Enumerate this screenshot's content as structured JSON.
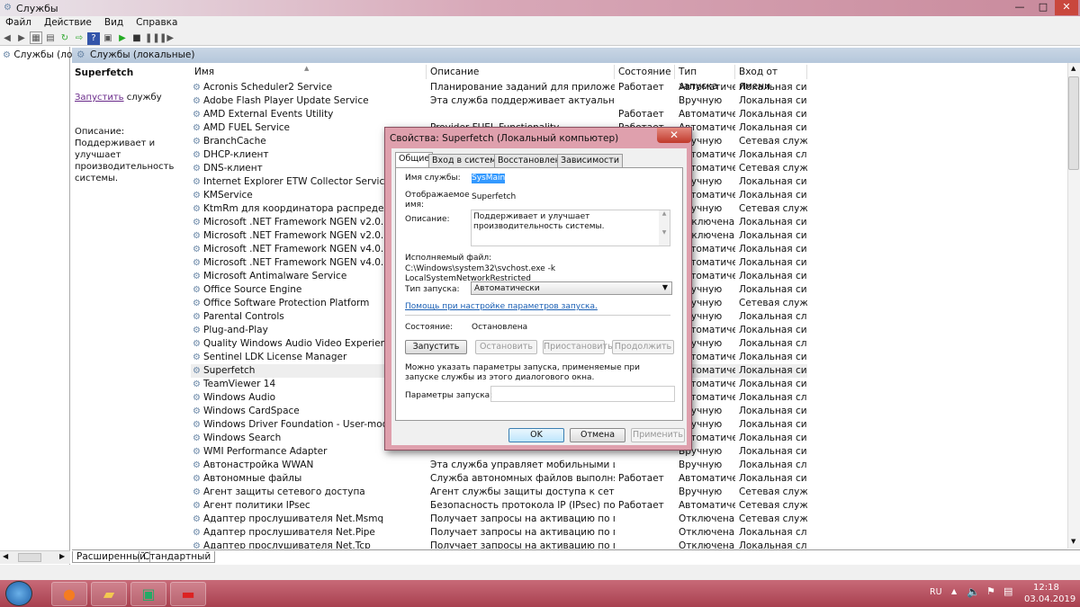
{
  "window": {
    "title": "Службы",
    "minimize": "—",
    "maximize": "□",
    "close": "✕"
  },
  "menu": [
    "Файл",
    "Действие",
    "Вид",
    "Справка"
  ],
  "toolbar_icons": [
    "back-icon",
    "forward-icon",
    "console-tree-icon",
    "properties-icon",
    "refresh-icon",
    "export-icon",
    "help-icon",
    "view-icon",
    "play-icon",
    "stop-icon",
    "pause-icon",
    "restart-icon"
  ],
  "tree": {
    "item": "Службы (лока"
  },
  "pane": {
    "title": "Службы (локальные)"
  },
  "detail": {
    "name": "Superfetch",
    "start_link": "Запустить",
    "start_suffix": " службу",
    "desc_label": "Описание:",
    "desc": "Поддерживает и улучшает производительность системы."
  },
  "columns": [
    "Имя",
    "Описание",
    "Состояние",
    "Тип запуска",
    "Вход от имени"
  ],
  "rows": [
    [
      "Acronis Scheduler2 Service",
      "Планирование заданий для приложений Ac...",
      "Работает",
      "Автоматиче...",
      "Локальная сис..."
    ],
    [
      "Adobe Flash Player Update Service",
      "Эта служба поддерживает актуальность уста...",
      "",
      "Вручную",
      "Локальная сис..."
    ],
    [
      "AMD External Events Utility",
      "",
      "Работает",
      "Автоматиче...",
      "Локальная сис..."
    ],
    [
      "AMD FUEL Service",
      "Provider FUEL Functionality",
      "Работает",
      "Автоматиче...",
      "Локальная сис..."
    ],
    [
      "BranchCache",
      "",
      "",
      "Вручную",
      "Сетевая служба"
    ],
    [
      "DHCP-клиент",
      "",
      "",
      "Автоматиче...",
      "Локальная слу..."
    ],
    [
      "DNS-клиент",
      "",
      "",
      "Автоматиче...",
      "Сетевая служба"
    ],
    [
      "Internet Explorer ETW Collector Service",
      "",
      "",
      "Вручную",
      "Локальная сис..."
    ],
    [
      "KMService",
      "",
      "",
      "Автоматиче...",
      "Локальная сис..."
    ],
    [
      "KtmRm для координатора распределенных тр...",
      "",
      "",
      "Вручную",
      "Сетевая служба"
    ],
    [
      "Microsoft .NET Framework NGEN v2.0.50727_X64",
      "",
      "",
      "Отключена",
      "Локальная сис..."
    ],
    [
      "Microsoft .NET Framework NGEN v2.0.50727_X86",
      "",
      "",
      "Отключена",
      "Локальная сис..."
    ],
    [
      "Microsoft .NET Framework NGEN v4.0.30319_X64",
      "",
      "",
      "Автоматиче...",
      "Локальная сис..."
    ],
    [
      "Microsoft .NET Framework NGEN v4.0.30319_X86",
      "",
      "",
      "Автоматиче...",
      "Локальная сис..."
    ],
    [
      "Microsoft Antimalware Service",
      "",
      "",
      "Автоматиче...",
      "Локальная сис..."
    ],
    [
      "Office  Source Engine",
      "",
      "",
      "Вручную",
      "Локальная сис..."
    ],
    [
      "Office Software Protection Platform",
      "",
      "",
      "Вручную",
      "Сетевая служба"
    ],
    [
      "Parental Controls",
      "",
      "",
      "Вручную",
      "Локальная слу..."
    ],
    [
      "Plug-and-Play",
      "",
      "",
      "Автоматиче...",
      "Локальная сис..."
    ],
    [
      "Quality Windows Audio Video Experience",
      "",
      "",
      "Вручную",
      "Локальная слу..."
    ],
    [
      "Sentinel LDK License Manager",
      "",
      "",
      "Автоматиче...",
      "Локальная сис..."
    ],
    [
      "Superfetch",
      "",
      "",
      "Автоматиче...",
      "Локальная сис..."
    ],
    [
      "TeamViewer 14",
      "",
      "",
      "Автоматиче...",
      "Локальная сис..."
    ],
    [
      "Windows Audio",
      "",
      "",
      "Автоматиче...",
      "Локальная слу..."
    ],
    [
      "Windows CardSpace",
      "",
      "",
      "Вручную",
      "Локальная сис..."
    ],
    [
      "Windows Driver Foundation - User-mode Driver Fr...",
      "",
      "",
      "Вручную",
      "Локальная сис..."
    ],
    [
      "Windows Search",
      "",
      "",
      "Автоматиче...",
      "Локальная сис..."
    ],
    [
      "WMI Performance Adapter",
      "",
      "",
      "Вручную",
      "Локальная сис..."
    ],
    [
      "Автонастройка WWAN",
      "Эта служба управляет мобильными широко...",
      "",
      "Вручную",
      "Локальная слу..."
    ],
    [
      "Автономные файлы",
      "Служба автономных файлов выполняет раб...",
      "Работает",
      "Автоматиче...",
      "Локальная сис..."
    ],
    [
      "Агент защиты сетевого доступа",
      "Агент службы защиты доступа к сети собира...",
      "",
      "Вручную",
      "Сетевая служба"
    ],
    [
      "Агент политики IPsec",
      "Безопасность протокола IP (IPsec) поддержи...",
      "Работает",
      "Автоматиче...",
      "Сетевая служба"
    ],
    [
      "Адаптер прослушивателя Net.Msmq",
      "Получает запросы на активацию по проток...",
      "",
      "Отключена",
      "Сетевая служба"
    ],
    [
      "Адаптер прослушивателя Net.Pipe",
      "Получает запросы на активацию по проток...",
      "",
      "Отключена",
      "Локальная слу..."
    ],
    [
      "Адаптер прослушивателя Net.Tcp",
      "Получает запросы на активацию по проток...",
      "",
      "Отключена",
      "Локальная слу..."
    ]
  ],
  "selected_row": 21,
  "view_tabs": [
    "Расширенный",
    "Стандартный"
  ],
  "dialog": {
    "title": "Свойства: Superfetch (Локальный компьютер)",
    "close": "✕",
    "tabs": [
      "Общие",
      "Вход в систему",
      "Восстановление",
      "Зависимости"
    ],
    "service_name_label": "Имя службы:",
    "service_name": "SysMain",
    "display_name_label": "Отображаемое имя:",
    "display_name": "Superfetch",
    "desc_label": "Описание:",
    "desc": "Поддерживает и улучшает производительность системы.",
    "exe_label": "Исполняемый файл:",
    "exe": "C:\\Windows\\system32\\svchost.exe -k LocalSystemNetworkRestricted",
    "startup_label": "Тип запуска:",
    "startup_value": "Автоматически",
    "help_link": "Помощь при настройке параметров запуска.",
    "state_label": "Состояние:",
    "state": "Остановлена",
    "btn_start": "Запустить",
    "btn_stop": "Остановить",
    "btn_pause": "Приостановить",
    "btn_resume": "Продолжить",
    "params_note": "Можно указать параметры запуска, применяемые при запуске службы из этого диалогового окна.",
    "params_label": "Параметры запуска:",
    "params_value": "",
    "ok": "OK",
    "cancel": "Отмена",
    "apply": "Применить"
  },
  "taskbar": {
    "lang": "RU",
    "time": "12:18",
    "date": "03.04.2019"
  }
}
